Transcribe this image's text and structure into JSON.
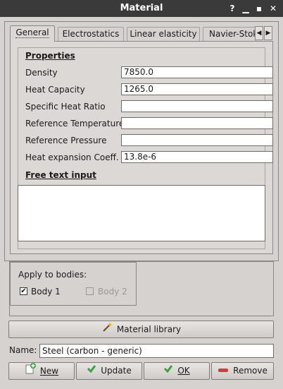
{
  "window": {
    "title": "Material",
    "controls": {
      "close": "✕",
      "maximize": "▪",
      "minimize": "▁",
      "help": "?"
    }
  },
  "tabs": [
    {
      "label": "General",
      "active": true
    },
    {
      "label": "Electrostatics",
      "active": false
    },
    {
      "label": "Linear elasticity",
      "active": false
    },
    {
      "label": "Navier-Stokes",
      "active": false
    }
  ],
  "properties": {
    "heading": "Properties",
    "rows": [
      {
        "label": "Density",
        "value": "7850.0"
      },
      {
        "label": "Heat Capacity",
        "value": "1265.0"
      },
      {
        "label": "Specific Heat Ratio",
        "value": ""
      },
      {
        "label": "Reference Temperature",
        "value": ""
      },
      {
        "label": "Reference Pressure",
        "value": ""
      },
      {
        "label": "Heat expansion Coeff.",
        "value": "13.8e-6"
      }
    ]
  },
  "free_text": {
    "heading": "Free text input",
    "value": ""
  },
  "bodies": {
    "heading": "Apply to bodies:",
    "items": [
      {
        "label": "Body 1",
        "checked": true,
        "enabled": true
      },
      {
        "label": "Body 2",
        "checked": false,
        "enabled": false
      }
    ]
  },
  "library_button": {
    "label": "Material library",
    "icon": "magic-wand-icon"
  },
  "name": {
    "label": "Name:",
    "value": "Steel (carbon - generic)"
  },
  "buttons": {
    "new": {
      "label": "New",
      "icon": "new-document-icon"
    },
    "update": {
      "label": "Update",
      "icon": "check-icon"
    },
    "ok": {
      "label": "OK",
      "icon": "check-icon"
    },
    "remove": {
      "label": "Remove",
      "icon": "remove-icon"
    }
  },
  "colors": {
    "titlebar": "#3a3a3a",
    "check_green": "#3da33d",
    "remove_red": "#d23c3c"
  }
}
